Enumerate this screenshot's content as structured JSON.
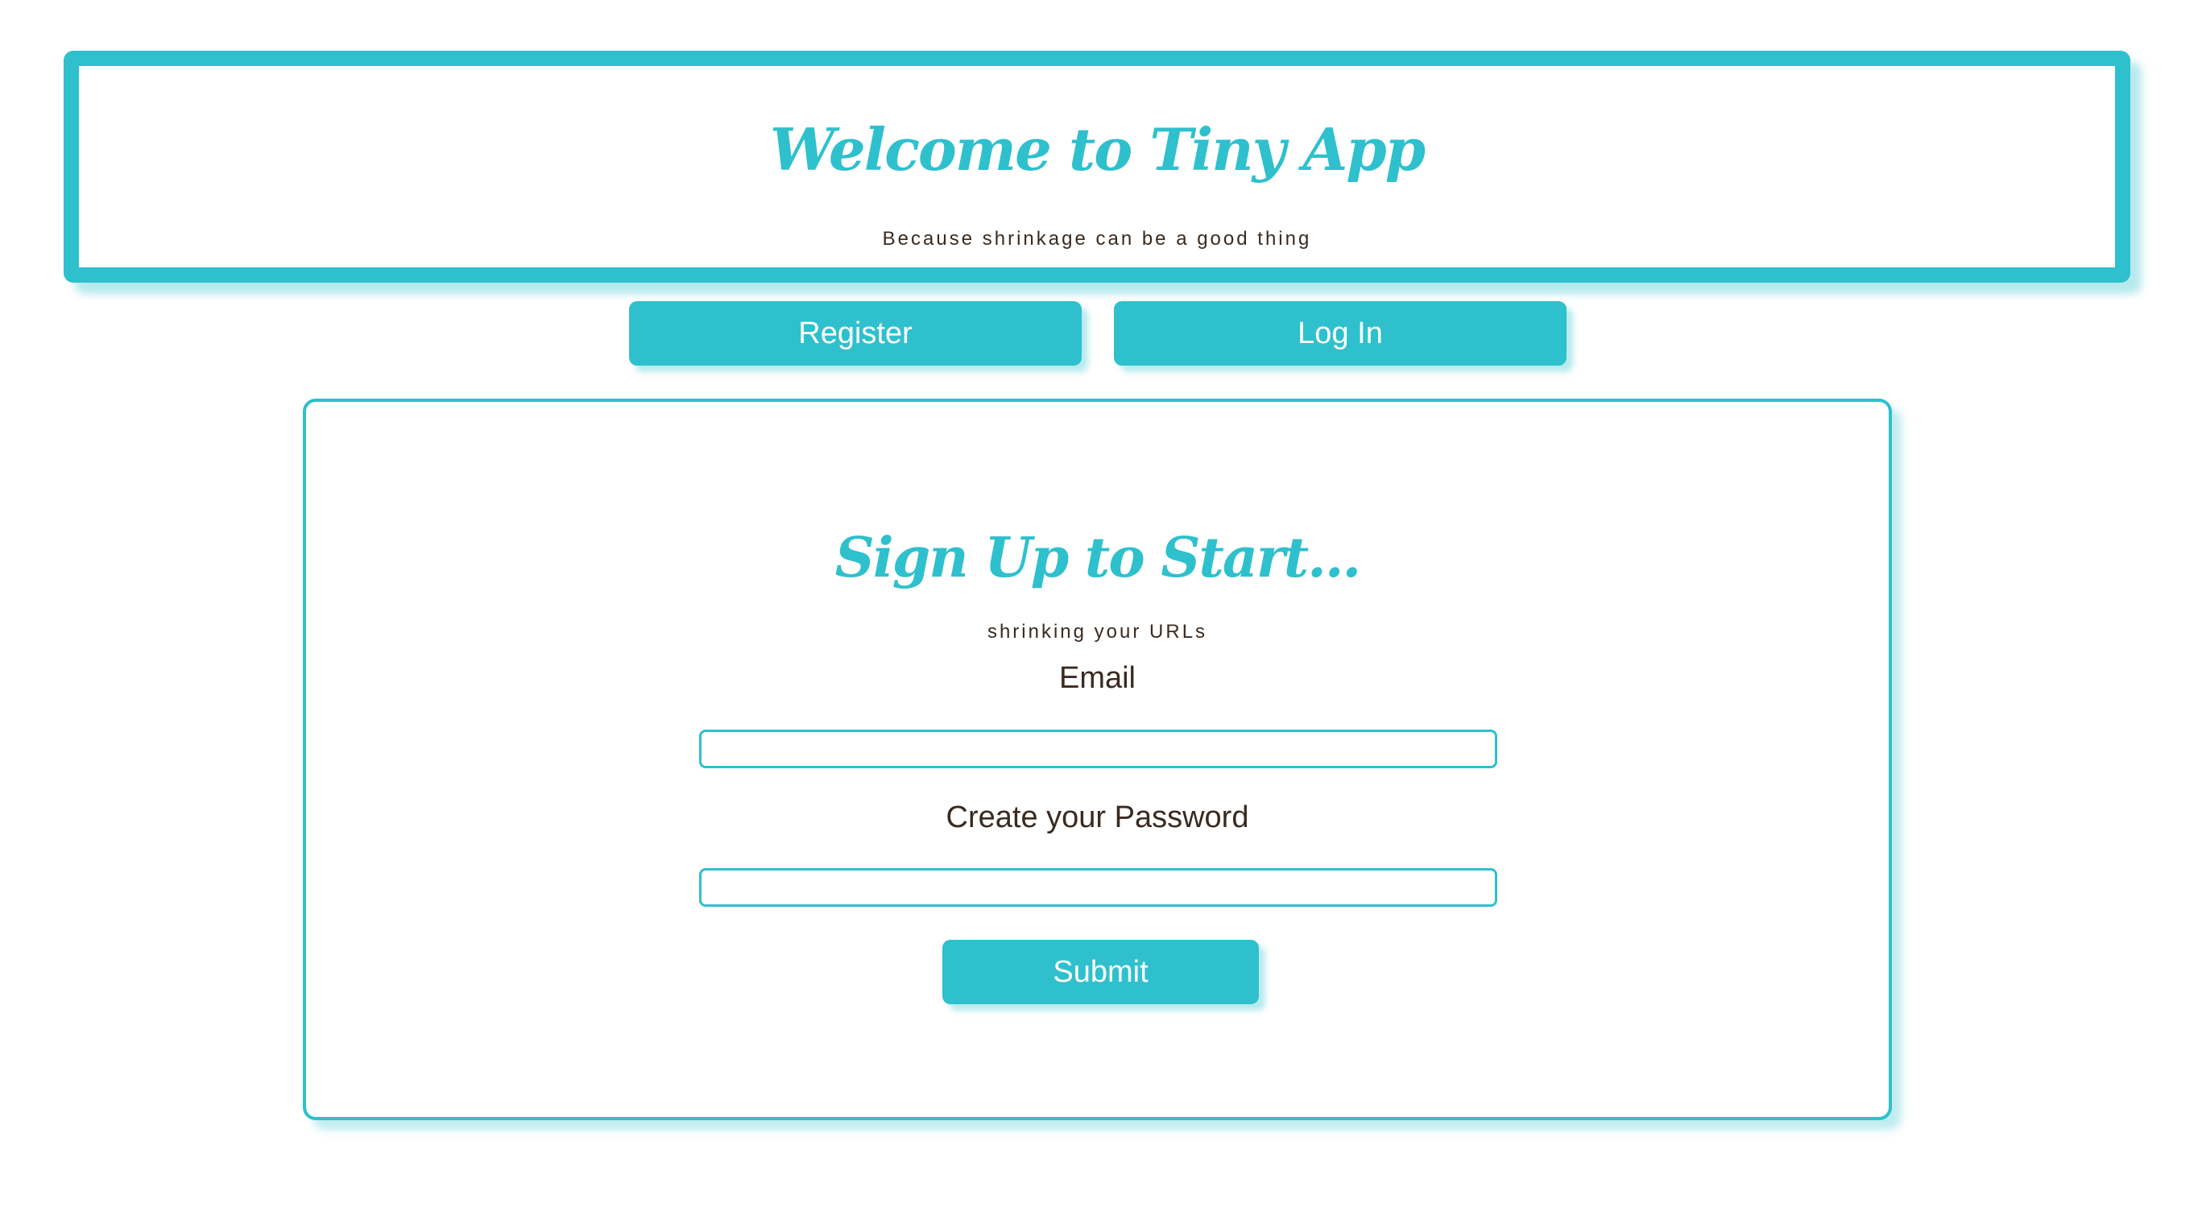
{
  "header": {
    "title": "Welcome to Tiny App",
    "subtitle": "Because shrinkage can be a good thing"
  },
  "nav": {
    "register_label": "Register",
    "login_label": "Log In"
  },
  "form": {
    "title": "Sign Up to Start...",
    "subtitle": "shrinking your URLs",
    "email_label": "Email",
    "email_value": "",
    "password_label": "Create your Password",
    "password_value": "",
    "submit_label": "Submit"
  },
  "colors": {
    "accent": "#2fc0cd",
    "text": "#3a2a1f",
    "background": "#ffffff"
  }
}
